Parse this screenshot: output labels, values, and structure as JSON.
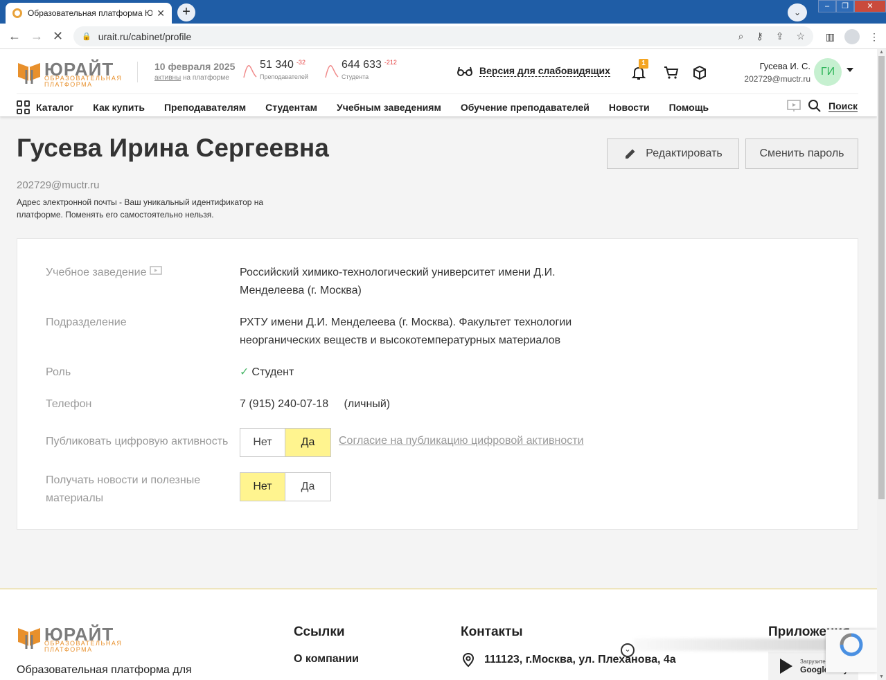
{
  "browser": {
    "tab_title": "Образовательная платформа Ю",
    "tab_close": "✕",
    "new_tab": "+",
    "url": "urait.ru/cabinet/profile"
  },
  "header": {
    "logo_name": "ЮРАЙТ",
    "logo_sub": "ОБРАЗОВАТЕЛЬНАЯ ПЛАТФОРМА",
    "date": "10 февраля 2025",
    "active_link": "активны",
    "active_rest": "на платформе",
    "teachers": {
      "value": "51 340",
      "delta": "-32",
      "label": "Преподавателей"
    },
    "students": {
      "value": "644 633",
      "delta": "-212",
      "label": "Студента"
    },
    "low_vision": "Версия для слабовидящих",
    "notifications_count": "1",
    "user_name": "Гусева И. С.",
    "user_email": "202729@muctr.ru",
    "avatar_initials": "ГИ"
  },
  "menu": {
    "catalog": "Каталог",
    "how_to_buy": "Как купить",
    "teachers": "Преподавателям",
    "students": "Студентам",
    "institutions": "Учебным заведениям",
    "teacher_training": "Обучение преподавателей",
    "news": "Новости",
    "help": "Помощь",
    "search": "Поиск"
  },
  "profile": {
    "full_name": "Гусева Ирина Сергеевна",
    "edit_button": "Редактировать",
    "change_password_button": "Сменить пароль",
    "email": "202729@muctr.ru",
    "email_note": "Адрес электронной почты - Ваш уникальный идентификатор на платформе. Поменять его самостоятельно нельзя.",
    "fields": {
      "institution_label": "Учебное заведение",
      "institution_value": "Российский химико-технологический университет имени Д.И. Менделеева (г. Москва)",
      "department_label": "Подразделение",
      "department_value": "РХТУ имени Д.И. Менделеева (г. Москва). Факультет технологии неорганических веществ и высокотемпературных материалов",
      "role_label": "Роль",
      "role_value": "Студент",
      "phone_label": "Телефон",
      "phone_value": "7 (915) 240-07-18",
      "phone_type": "(личный)",
      "publish_label": "Публиковать цифровую активность",
      "publish_no": "Нет",
      "publish_yes": "Да",
      "publish_selected": "Да",
      "consent_link": "Согласие на публикацию цифровой активности",
      "news_label": "Получать новости и полезные материалы",
      "news_no": "Нет",
      "news_yes": "Да",
      "news_selected": "Нет"
    }
  },
  "footer": {
    "description": "Образовательная платформа для",
    "links_heading": "Ссылки",
    "about_link": "О компании",
    "contacts_heading": "Контакты",
    "address": "111123, г.Москва, ул. Плеханова, 4а",
    "apps_heading": "Приложения",
    "gplay_line1": "Загрузите в",
    "gplay_line2": "Google Play"
  },
  "colors": {
    "accent_yellow": "#fff48f",
    "brand_orange": "#e8902c",
    "avatar_bg": "#c6f0d0",
    "badge": "#f4a522"
  }
}
